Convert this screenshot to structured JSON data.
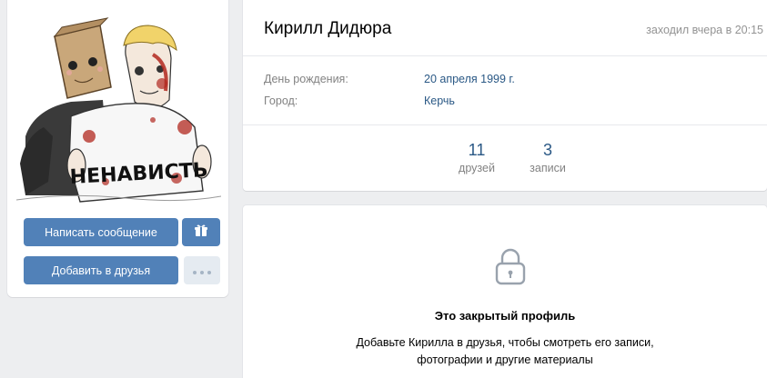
{
  "profile": {
    "name": "Кирилл Дидюра",
    "last_seen": "заходил вчера в 20:15",
    "birthday_label": "День рождения:",
    "birthday_value": "20 апреля 1999 г.",
    "city_label": "Город:",
    "city_value": "Керчь"
  },
  "avatar": {
    "shirt_text": "НЕНАВИСТЬ"
  },
  "counters": [
    {
      "value": "11",
      "label": "друзей"
    },
    {
      "value": "3",
      "label": "записи"
    }
  ],
  "actions": {
    "message_label": "Написать сообщение",
    "add_friend_label": "Добавить в друзья",
    "gift_icon": "gift-icon",
    "more_icon": "more-dots-icon"
  },
  "closed_profile": {
    "icon": "lock-icon",
    "title": "Это закрытый профиль",
    "description": "Добавьте Кирилла в друзья, чтобы смотреть его записи, фотографии и другие материалы"
  },
  "colors": {
    "accent": "#5181b8",
    "link": "#2a5885",
    "background": "#edeef0",
    "muted": "#828282"
  }
}
